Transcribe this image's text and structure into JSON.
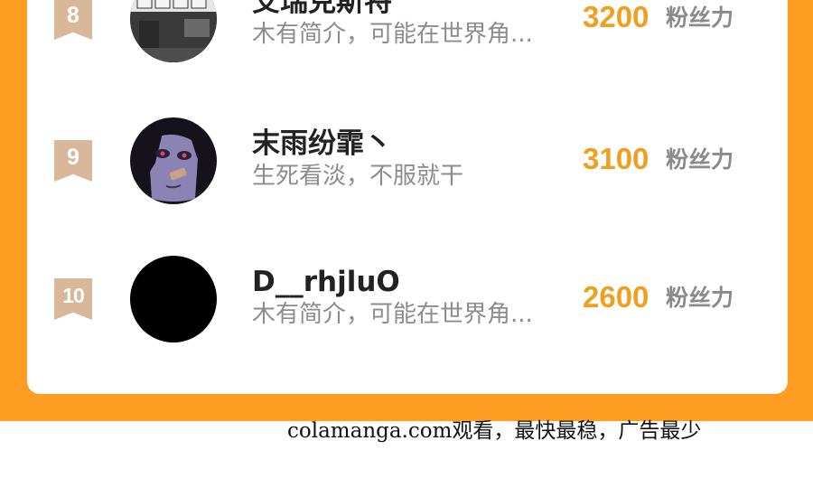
{
  "ranking": [
    {
      "rank": "8",
      "name": "艾瑞克斯特",
      "bio": "木有简介，可能在世界角...",
      "score": "3200",
      "score_label": "粉丝力",
      "avatar_icon": "shop-photo-avatar"
    },
    {
      "rank": "9",
      "name": "末雨纷霏丶",
      "bio": "生死看淡，不服就干",
      "score": "3100",
      "score_label": "粉丝力",
      "avatar_icon": "anime-girl-avatar"
    },
    {
      "rank": "10",
      "name": "D__rhjluO",
      "bio": "木有简介，可能在世界角...",
      "score": "2600",
      "score_label": "粉丝力",
      "avatar_icon": "black-circle-avatar"
    }
  ],
  "watermark": "colamanga.com观看，最快最稳，广告最少",
  "colors": {
    "accent_orange": "#ff9d23",
    "score_orange": "#f0a020",
    "rank_badge": "#d9b79b",
    "card_background": "#ffffff"
  }
}
